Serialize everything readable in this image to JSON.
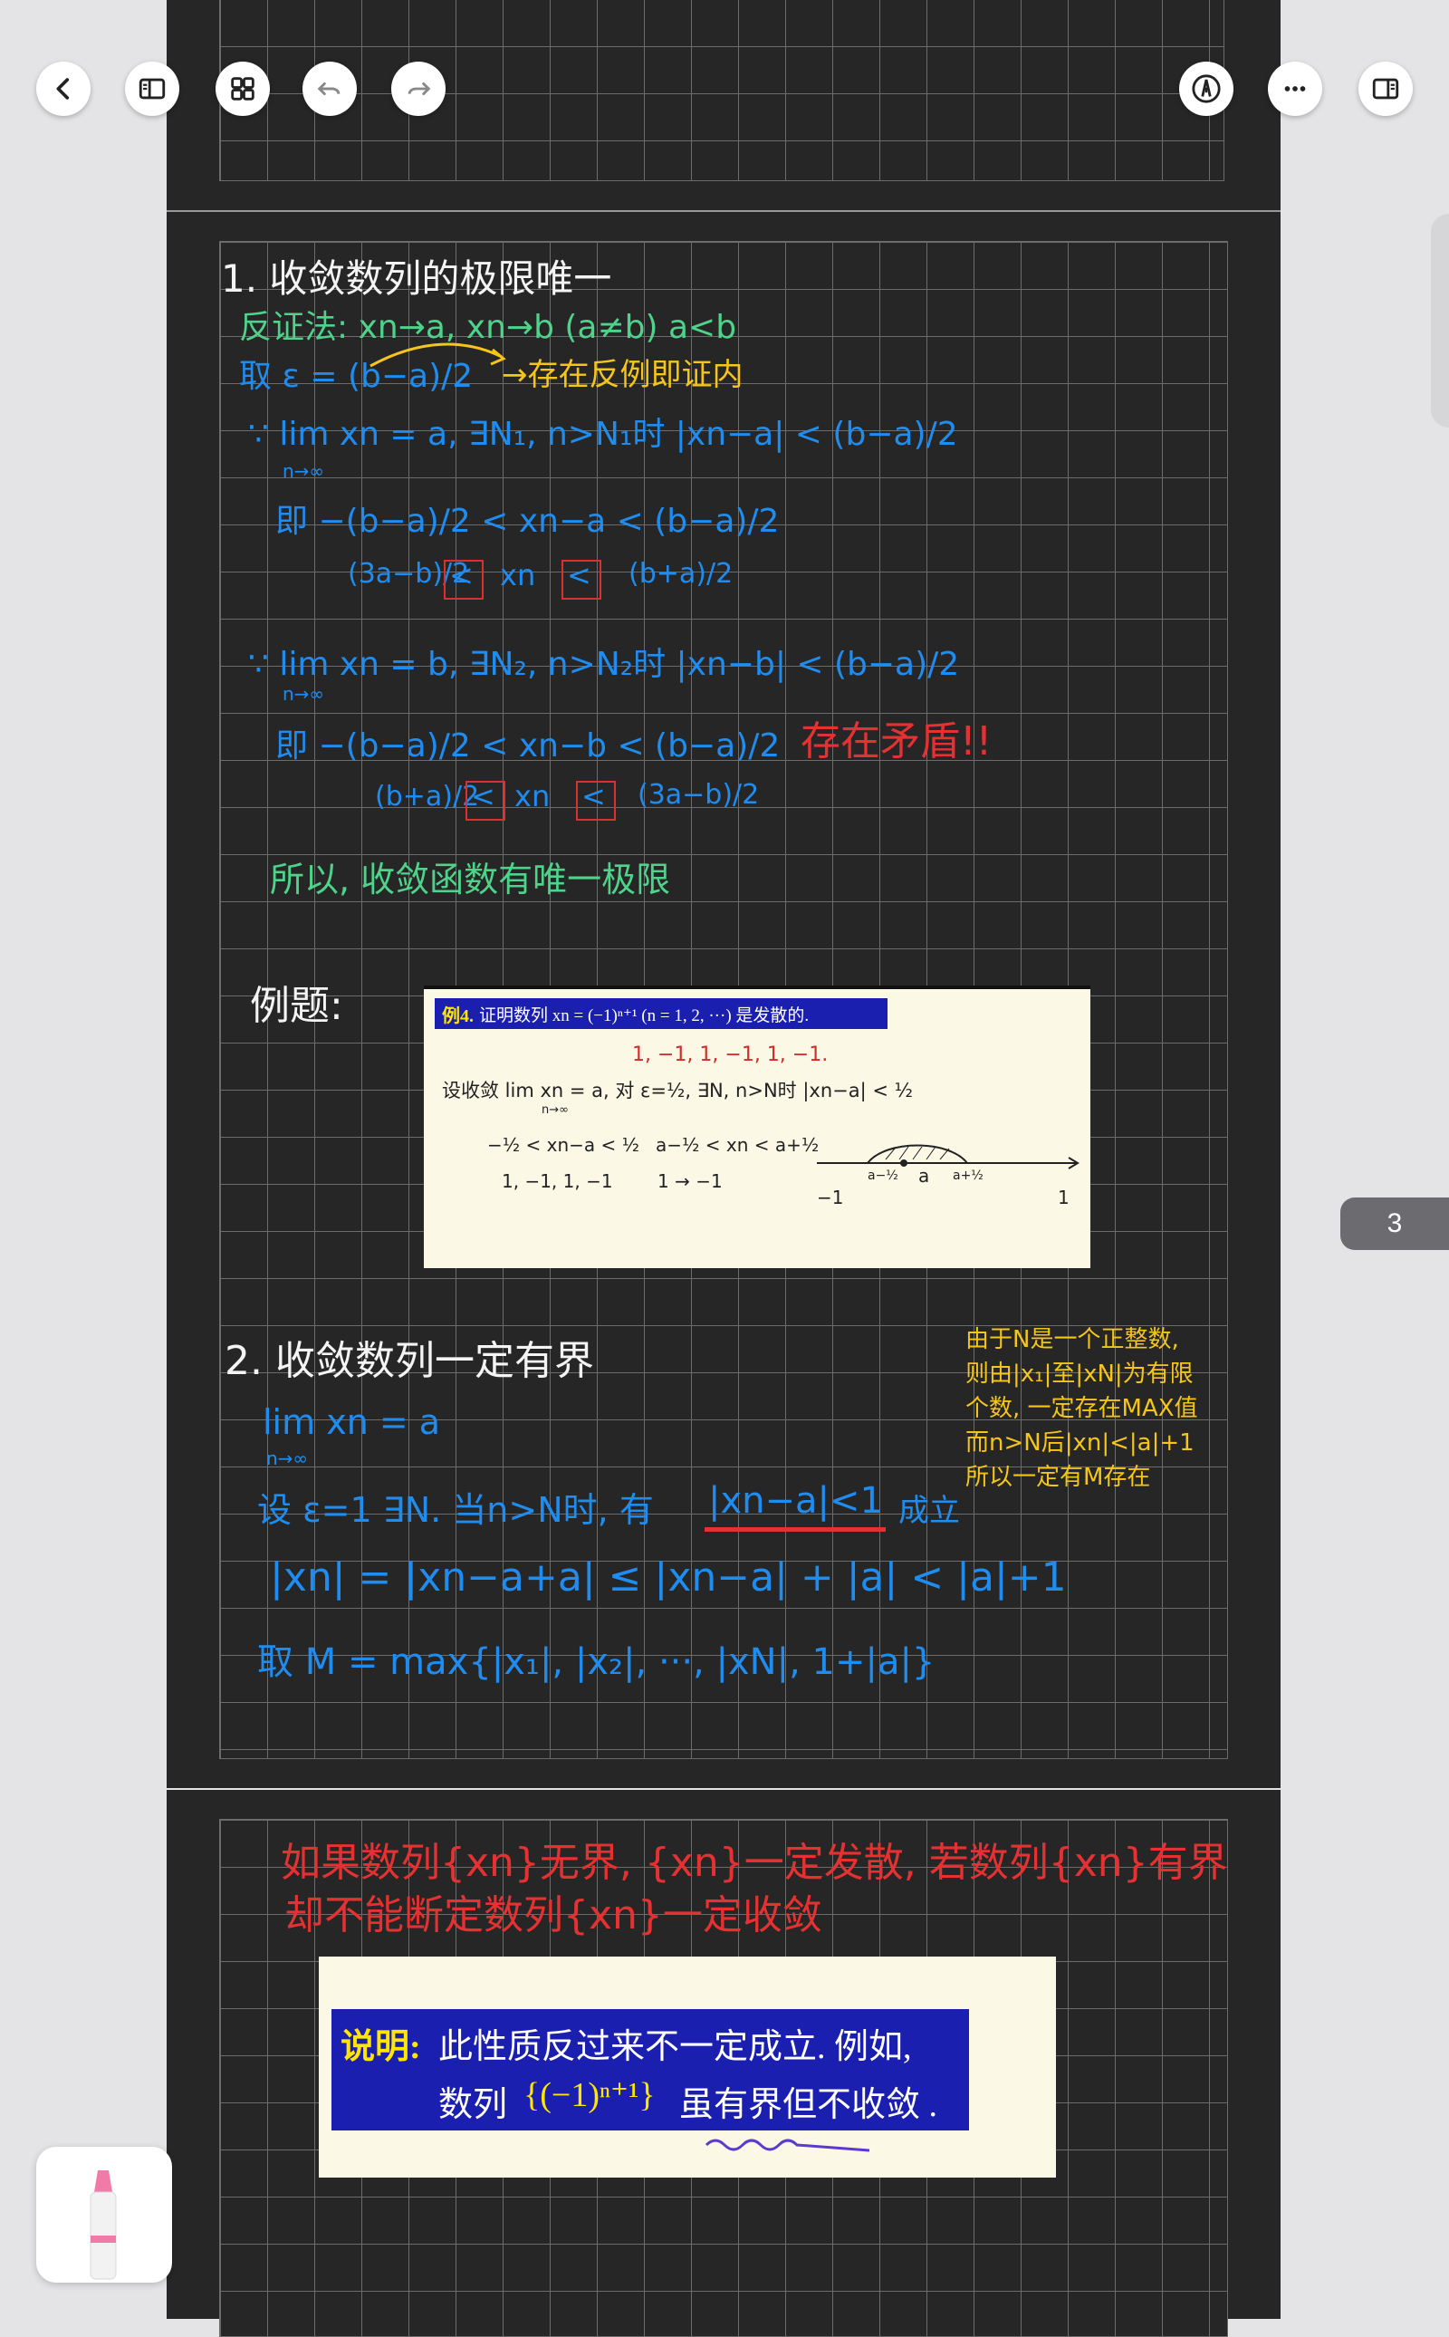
{
  "toolbar": {
    "back_icon": "chevron-left-icon",
    "sidebar_icon": "sidebar-icon",
    "grid_icon": "grid-icon",
    "undo_icon": "undo-icon",
    "redo_icon": "redo-icon",
    "pen_icon": "pen-nib-icon",
    "more_icon": "more-icon",
    "panel_icon": "panel-icon"
  },
  "page_indicator": "3",
  "colors": {
    "blue": "#1f8cf0",
    "green": "#4fd28a",
    "yellow": "#f5c51a",
    "red": "#e53131",
    "white": "#f4f4f4",
    "orange": "#f5a623"
  },
  "section1": {
    "title": "1. 收敛数列的极限唯一",
    "line_fanzheng": "反证法: xn→a, xn→b (a≠b) a<b",
    "line_take_eps": "取 ε = (b−a)/2",
    "line_note": "→存在反例即证内",
    "line_lim_a": "∵ lim xn = a, ∃N₁, n>N₁时 |xn−a| < (b−a)/2",
    "line_lim_a_sub": "n→∞",
    "line_ji_a": "即 −(b−a)/2 < xn−a < (b−a)/2",
    "line_ineq_a_left": "(3a−b)/2",
    "line_ineq_a_lt1": "<",
    "line_ineq_a_mid": "xn",
    "line_ineq_a_lt2": "<",
    "line_ineq_a_right": "(b+a)/2",
    "line_lim_b": "∵ lim xn = b, ∃N₂, n>N₂时 |xn−b| < (b−a)/2",
    "line_lim_b_sub": "n→∞",
    "line_ji_b": "即 −(b−a)/2 < xn−b < (b−a)/2",
    "line_contradiction": "存在矛盾!!",
    "line_ineq_b_left": "(b+a)/2",
    "line_ineq_b_lt1": "<",
    "line_ineq_b_mid": "xn",
    "line_ineq_b_lt2": "<",
    "line_ineq_b_right": "(3a−b)/2",
    "conclusion": "所以, 收敛函数有唯一极限"
  },
  "example": {
    "label": "例题:",
    "heading_tag": "例4.",
    "heading_text": "证明数列 xn = (−1)ⁿ⁺¹ (n = 1, 2, ···) 是发散的.",
    "sequence": "1, −1, 1, −1, 1, −1.",
    "assume": "设收敛 lim xn = a,  对 ε=½,  ∃N, n>N时  |xn−a| < ½",
    "assume_sub": "n→∞",
    "ineq1": "−½ < xn−a < ½",
    "ineq2": "a−½ < xn < a+½",
    "vals1": "1, −1, 1, −1",
    "vals2": "1 → −1",
    "numline_left": "−1",
    "numline_right": "1",
    "numline_a": "a",
    "numline_a_minus": "a−½",
    "numline_a_plus": "a+½"
  },
  "section2": {
    "title": "2. 收敛数列一定有界",
    "side_note": [
      "由于N是一个正整数,",
      "则由|x₁|至|xN|为有限",
      "个数, 一定存在MAX值",
      "而n>N后|xn|<|a|+1",
      "所以一定有M存在"
    ],
    "line_lim": "lim xn = a",
    "line_lim_sub": "n→∞",
    "line_eps": "设 ε=1  ∃N. 当n>N时, 有",
    "line_eps_under": "|xn−a|<1",
    "line_eps_tail": "成立",
    "line_bound": "|xn| = |xn−a+a| ≤ |xn−a| + |a| < |a|+1",
    "line_M": "取 M = max{|x₁|, |x₂|, ···, |xN|, 1+|a|}"
  },
  "section3": {
    "red_note_1": "如果数列{xn}无界, {xn}一定发散, 若数列{xn}有界",
    "red_note_2": "却不能断定数列{xn}一定收敛",
    "box_label": "说明:",
    "box_line1": "此性质反过来不一定成立. 例如,",
    "box_line2_a": "数列",
    "box_line2_formula": "{(−1)ⁿ⁺¹}",
    "box_line2_b": "虽有界但不收敛 ."
  },
  "tool": {
    "name": "highlighter-icon"
  }
}
